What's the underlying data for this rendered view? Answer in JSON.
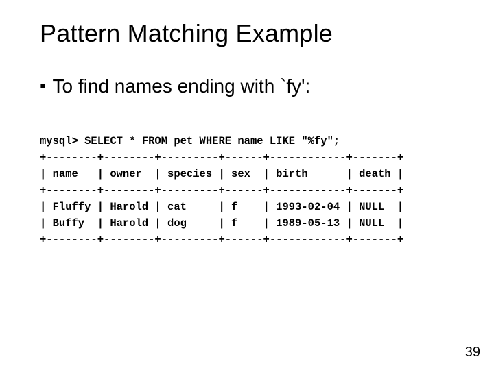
{
  "title": "Pattern Matching Example",
  "bullet": "To find names ending with `fy':",
  "code": {
    "l0": "mysql> SELECT * FROM pet WHERE name LIKE \"%fy\";",
    "l1": "+--------+--------+---------+------+------------+-------+",
    "l2": "| name   | owner  | species | sex  | birth      | death |",
    "l3": "+--------+--------+---------+------+------------+-------+",
    "l4": "| Fluffy | Harold | cat     | f    | 1993-02-04 | NULL  |",
    "l5": "| Buffy  | Harold | dog     | f    | 1989-05-13 | NULL  |",
    "l6": "+--------+--------+---------+------+------------+-------+"
  },
  "page_number": "39"
}
